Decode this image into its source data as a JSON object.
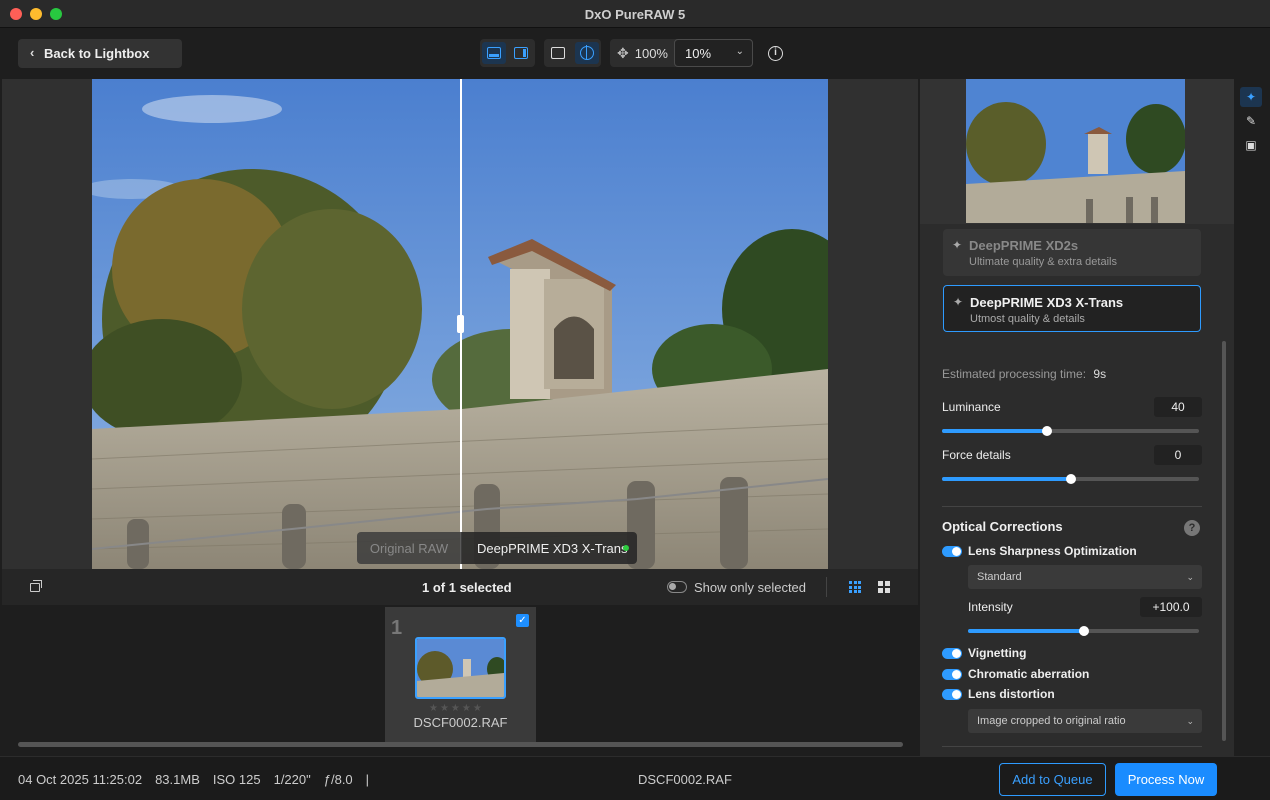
{
  "window": {
    "title": "DxO PureRAW 5"
  },
  "toolbar": {
    "back_label": "Back to Lightbox",
    "zoom_fit": "100%",
    "zoom_value": "10%"
  },
  "compare": {
    "left_label": "Original RAW",
    "right_label": "DeepPRIME XD3 X-Trans"
  },
  "filmstrip": {
    "selection_count": "1 of 1 selected",
    "show_only_selected": "Show only selected",
    "items": [
      {
        "number": "1",
        "filename": "DSCF0002.RAF",
        "selected": true
      }
    ]
  },
  "status": {
    "date": "04 Oct 2025 11:25:02",
    "size": "83.1MB",
    "iso": "ISO 125",
    "shutter": "1/220\"",
    "aperture": "ƒ/8.0",
    "divider": "|",
    "filename": "DSCF0002.RAF",
    "add_to_queue": "Add to Queue",
    "process_now": "Process Now"
  },
  "panel": {
    "options": [
      {
        "name": "DeepPRIME XD2s",
        "desc": "Ultimate quality & extra details"
      },
      {
        "name": "DeepPRIME XD3 X-Trans",
        "desc": "Utmost quality & details"
      }
    ],
    "estimated_label": "Estimated processing time:",
    "estimated_value": "9s",
    "luminance_label": "Luminance",
    "luminance_value": "40",
    "luminance_level": 0.41,
    "force_details_label": "Force details",
    "force_details_value": "0",
    "force_details_level": 0.5,
    "optical_title": "Optical Corrections",
    "help_glyph": "?",
    "lens_sharpness_label": "Lens Sharpness Optimization",
    "lens_sharpness_mode": "Standard",
    "intensity_label": "Intensity",
    "intensity_value": "+100.0",
    "intensity_level": 0.5,
    "vignetting_label": "Vignetting",
    "chromatic_label": "Chromatic aberration",
    "distortion_label": "Lens distortion",
    "distortion_mode": "Image cropped to original ratio"
  },
  "colors": {
    "accent": "#2e9bff",
    "process_button": "#1a8cff",
    "green_indicator": "#2ecc40"
  }
}
